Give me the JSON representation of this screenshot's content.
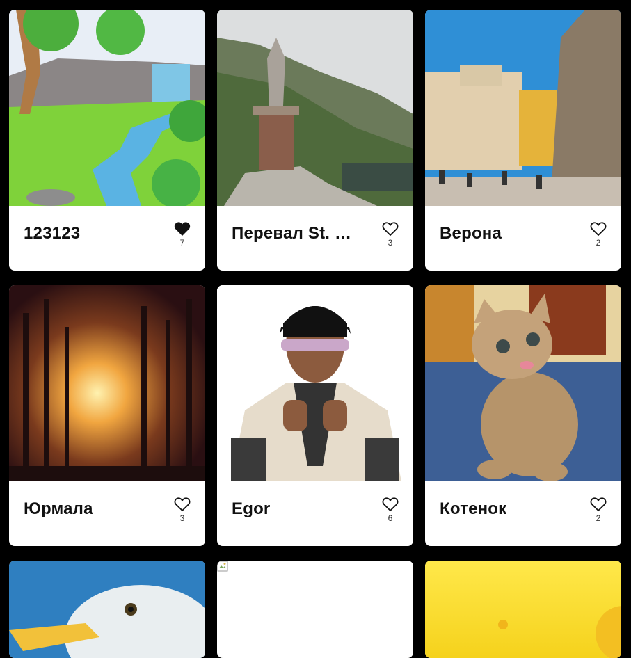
{
  "cards": [
    {
      "title": "123123",
      "likes": "7",
      "liked": true
    },
    {
      "title": "Перевал St. Gotthard",
      "likes": "3",
      "liked": false
    },
    {
      "title": "Верона",
      "likes": "2",
      "liked": false
    },
    {
      "title": "Юрмала",
      "likes": "3",
      "liked": false
    },
    {
      "title": "Egor",
      "likes": "6",
      "liked": false
    },
    {
      "title": "Котенок",
      "likes": "2",
      "liked": false
    }
  ]
}
